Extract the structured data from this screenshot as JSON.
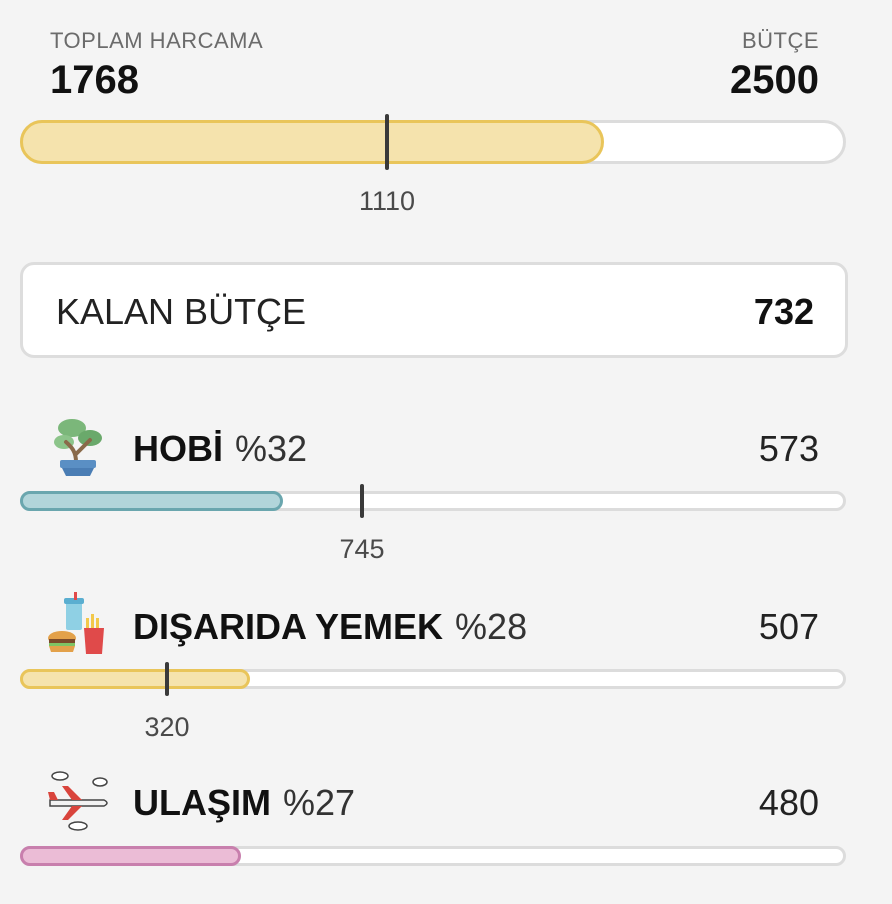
{
  "summary": {
    "total_label": "TOPLAM HARCAMA",
    "total_value": "1768",
    "budget_label": "BÜTÇE",
    "budget_value": "2500",
    "progress_fraction": 0.7072,
    "marker_value": "1110",
    "marker_fraction": 0.444,
    "colors": {
      "fill": "#f5e3ad",
      "border": "#e9c55a"
    }
  },
  "remaining": {
    "label": "KALAN BÜTÇE",
    "value": "732"
  },
  "categories": [
    {
      "icon": "bonsai-icon",
      "name": "HOBİ",
      "percent": "%32",
      "value": "573",
      "progress_fraction": 0.3185,
      "marker_value": "745",
      "marker_fraction": 0.4145,
      "colors": {
        "fill": "#b2d5da",
        "border": "#6aa6ae"
      }
    },
    {
      "icon": "fast-food-icon",
      "name": "DIŞARIDA YEMEK",
      "percent": "%28",
      "value": "507",
      "progress_fraction": 0.2786,
      "marker_value": "320",
      "marker_fraction": 0.1781,
      "colors": {
        "fill": "#f5e3ad",
        "border": "#e9c55a"
      }
    },
    {
      "icon": "airplane-icon",
      "name": "ULAŞIM",
      "percent": "%27",
      "value": "480",
      "progress_fraction": 0.2676,
      "colors": {
        "fill": "#ebbcd6",
        "border": "#c87fad"
      }
    }
  ]
}
